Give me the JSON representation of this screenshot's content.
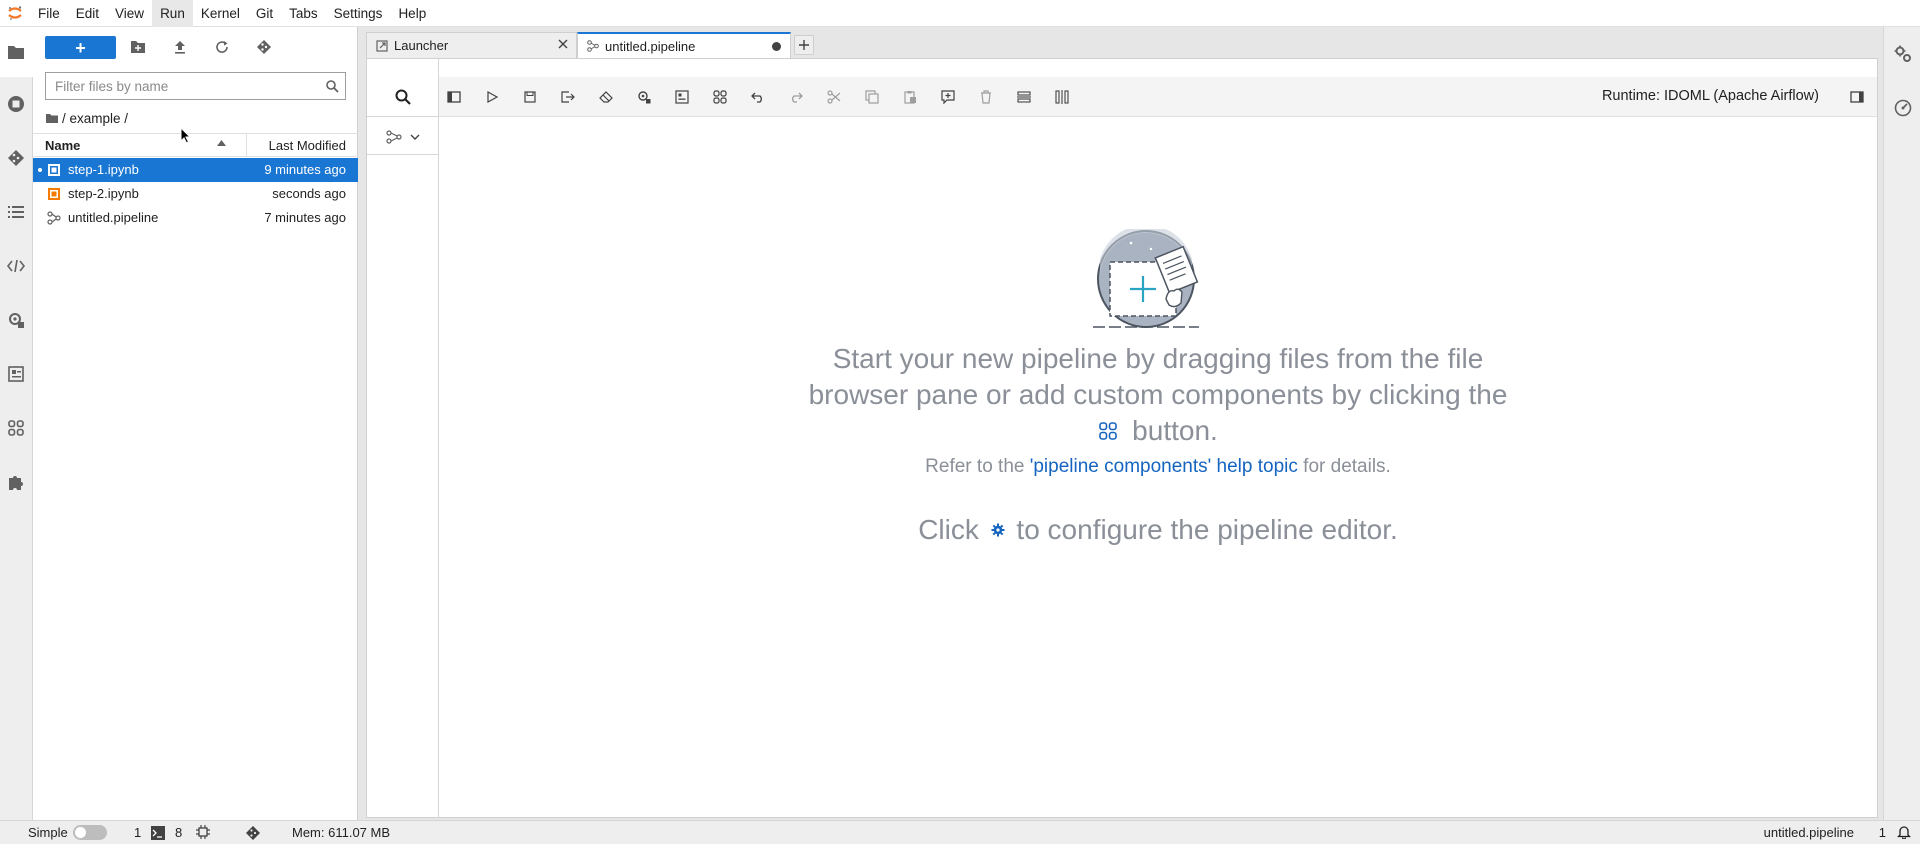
{
  "menubar": {
    "items": [
      "File",
      "Edit",
      "View",
      "Run",
      "Kernel",
      "Git",
      "Tabs",
      "Settings",
      "Help"
    ],
    "active": "Run"
  },
  "filebrowser": {
    "new_label": "+",
    "filter_placeholder": "Filter files by name",
    "breadcrumb": "/ example /",
    "col_name": "Name",
    "col_modified": "Last Modified",
    "files": [
      {
        "name": "step-1.ipynb",
        "modified": "9 minutes ago",
        "type": "notebook",
        "selected": true
      },
      {
        "name": "step-2.ipynb",
        "modified": "seconds ago",
        "type": "notebook",
        "selected": false
      },
      {
        "name": "untitled.pipeline",
        "modified": "7 minutes ago",
        "type": "pipeline",
        "selected": false
      }
    ]
  },
  "tabs": [
    {
      "label": "Launcher",
      "active": false
    },
    {
      "label": "untitled.pipeline",
      "active": true
    }
  ],
  "editor": {
    "runtime": "Runtime: IDOML (Apache Airflow)",
    "empty_line1": "Start your new pipeline by dragging files from the file",
    "empty_line2": "browser pane or add custom components by clicking the",
    "empty_line3": "button.",
    "ref_prefix": "Refer to the ",
    "ref_link": "'pipeline components' help topic",
    "ref_suffix": " for details.",
    "cfg_prefix": "Click ",
    "cfg_suffix": " to configure the pipeline editor."
  },
  "statusbar": {
    "mode": "Simple",
    "kernels": "1",
    "terminals": "8",
    "memory": "Mem: 611.07 MB",
    "current_file": "untitled.pipeline",
    "notifications": "1"
  },
  "colors": {
    "accent": "#1976d2",
    "link": "#1565c0",
    "notebook_icon": "#f57c00",
    "logo": "#f37726"
  }
}
